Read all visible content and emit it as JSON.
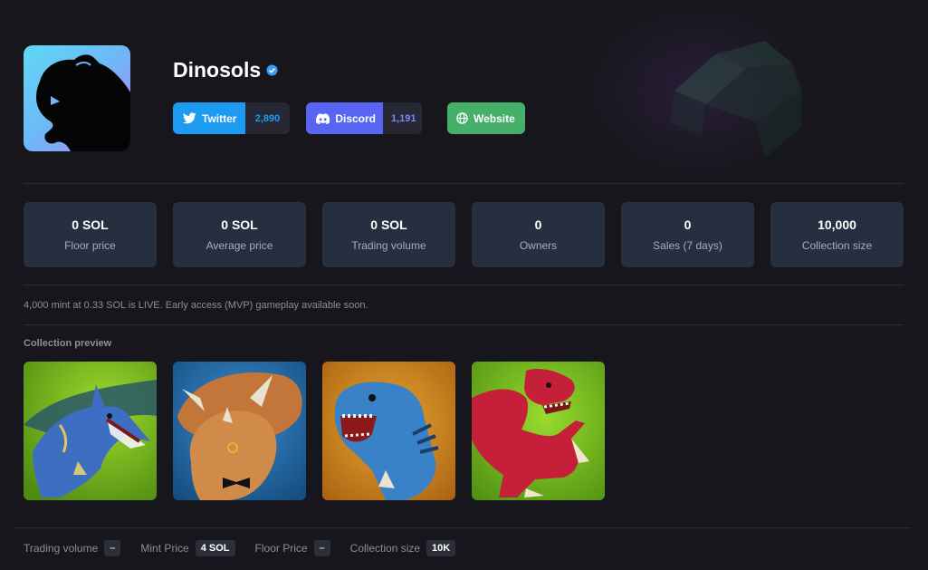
{
  "collection": {
    "name": "Dinosols",
    "verified": true,
    "description": "4,000 mint at 0.33 SOL is LIVE. Early access (MVP) gameplay available soon."
  },
  "social": {
    "twitter": {
      "label": "Twitter",
      "count": "2,890",
      "color": "#1d9bf0"
    },
    "discord": {
      "label": "Discord",
      "count": "1,191",
      "color": "#5865f2"
    },
    "website": {
      "label": "Website",
      "color": "#46b06a"
    }
  },
  "stats": [
    {
      "value": "0 SOL",
      "label": "Floor price"
    },
    {
      "value": "0 SOL",
      "label": "Average price"
    },
    {
      "value": "0 SOL",
      "label": "Trading volume"
    },
    {
      "value": "0",
      "label": "Owners"
    },
    {
      "value": "0",
      "label": "Sales (7 days)"
    },
    {
      "value": "10,000",
      "label": "Collection size"
    }
  ],
  "preview": {
    "label": "Collection preview",
    "items": [
      {
        "icon": "pterodactyl-nft-image"
      },
      {
        "icon": "triceratops-nft-image"
      },
      {
        "icon": "trex-nft-image"
      },
      {
        "icon": "raptor-nft-image"
      }
    ]
  },
  "footer": {
    "trading_volume_label": "Trading volume",
    "trading_volume_value": "–",
    "mint_price_label": "Mint Price",
    "mint_price_value": "4 SOL",
    "floor_price_label": "Floor Price",
    "floor_price_value": "–",
    "collection_size_label": "Collection size",
    "collection_size_value": "10K"
  }
}
